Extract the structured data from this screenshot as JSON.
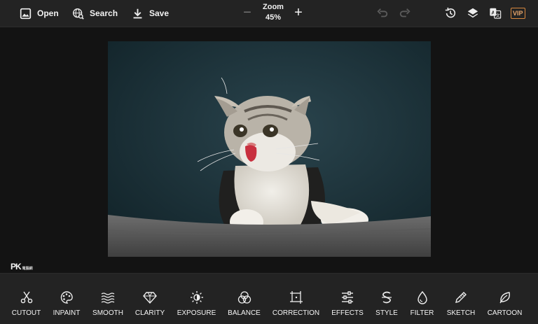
{
  "header": {
    "open_label": "Open",
    "search_label": "Search",
    "save_label": "Save",
    "zoom_label": "Zoom",
    "zoom_value": "45%",
    "vip_label": "VIP"
  },
  "watermark": {
    "brand": "PK",
    "sub": "電腦網"
  },
  "tools": [
    {
      "label": "CUTOUT",
      "icon": "scissors-icon"
    },
    {
      "label": "INPAINT",
      "icon": "palette-icon"
    },
    {
      "label": "SMOOTH",
      "icon": "waves-icon"
    },
    {
      "label": "CLARITY",
      "icon": "diamond-icon"
    },
    {
      "label": "EXPOSURE",
      "icon": "sun-icon"
    },
    {
      "label": "BALANCE",
      "icon": "color-circles-icon"
    },
    {
      "label": "CORRECTION",
      "icon": "crop-frame-icon"
    },
    {
      "label": "EFFECTS",
      "icon": "sliders-icon"
    },
    {
      "label": "STYLE",
      "icon": "style-s-icon"
    },
    {
      "label": "FILTER",
      "icon": "drop-icon"
    },
    {
      "label": "SKETCH",
      "icon": "pencil-icon"
    },
    {
      "label": "CARTOON",
      "icon": "leaf-icon"
    }
  ],
  "colors": {
    "panel": "#232323",
    "background": "#131313",
    "vip_accent": "#d8893f"
  }
}
